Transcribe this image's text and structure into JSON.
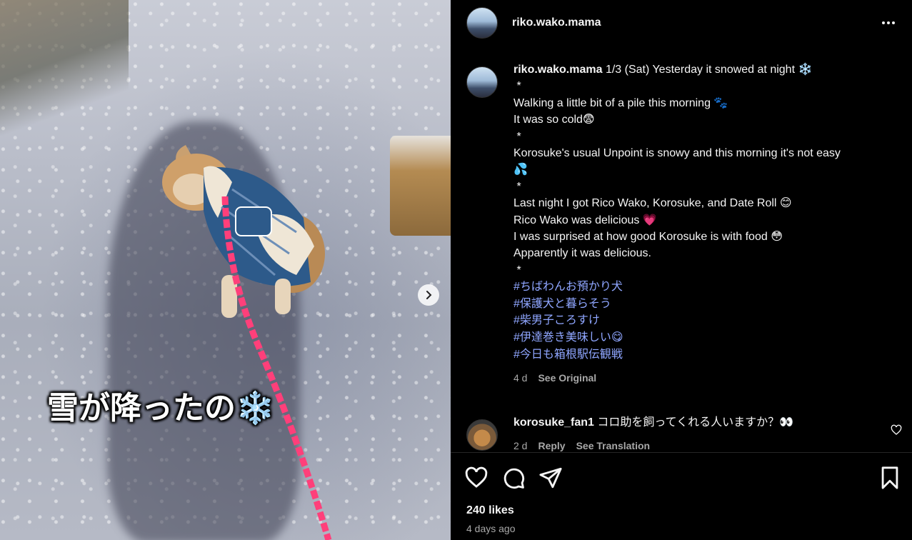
{
  "post": {
    "username": "riko.wako.mama",
    "photo_caption": "雪が降ったの❄️",
    "likes": "240 likes",
    "timestamp": "4 days ago"
  },
  "caption": {
    "username": "riko.wako.mama",
    "lines": [
      "1/3 (Sat) Yesterday it snowed at night ❄️",
      " *",
      "Walking a little bit of a pile this morning 🐾",
      "It was so cold😨",
      " *",
      "Korosuke's usual Unpoint is snowy and this morning it's not easy",
      "💦",
      " *",
      "Last night I got Rico Wako, Korosuke, and Date Roll 😊",
      "Rico Wako was delicious 💗",
      "I was surprised at how good Korosuke is with food 😳",
      "Apparently it was delicious.",
      " *"
    ],
    "hashtags": [
      "#ちばわんお預かり犬",
      "#保護犬と暮らそう",
      "#柴男子ころすけ",
      "#伊達巻き美味しい😋",
      "#今日も箱根駅伝観戦"
    ],
    "age": "4 d",
    "see_original": "See Original"
  },
  "reply": {
    "username": "korosuke_fan1",
    "text": "コロ助を飼ってくれる人いますか？👀",
    "age": "2 d",
    "reply_label": "Reply",
    "see_translation": "See Translation"
  },
  "icons": {
    "more": "more-horizontal-icon",
    "next": "chevron-right-icon",
    "like": "heart-icon",
    "comment": "comment-bubble-icon",
    "share": "paper-plane-icon",
    "save": "bookmark-icon"
  },
  "colors": {
    "background": "#000000",
    "hashtag": "#8fa6ff",
    "secondary_text": "#a8a8a8",
    "leash": "#ff3f7a"
  }
}
